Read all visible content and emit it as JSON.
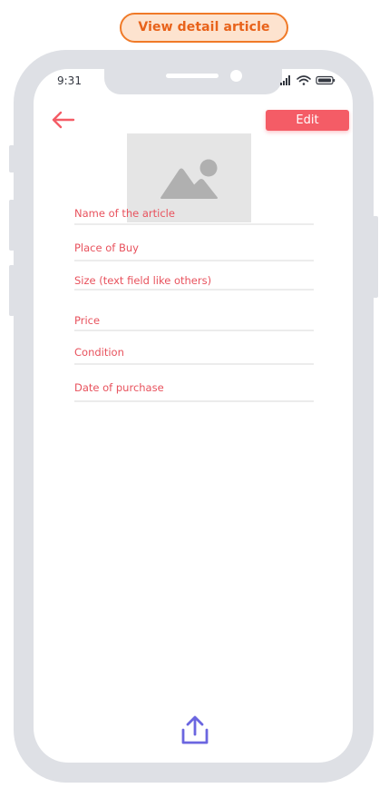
{
  "caption": "View detail article",
  "status_bar": {
    "time": "9:31",
    "icons": [
      "signal-icon",
      "wifi-icon",
      "battery-icon"
    ]
  },
  "header": {
    "back_icon": "arrow-left-icon",
    "edit_label": "Edit"
  },
  "image": {
    "icon": "image-placeholder-icon"
  },
  "fields": [
    {
      "label": "Name of the article"
    },
    {
      "label": "Place of Buy"
    },
    {
      "label": "Size (text field like others)"
    },
    {
      "label": "Price"
    },
    {
      "label": "Condition"
    },
    {
      "label": "Date of purchase"
    }
  ],
  "footer": {
    "share_icon": "share-upload-icon"
  },
  "colors": {
    "accent": "#f45c66",
    "label": "#e8525d",
    "caption_border": "#f07a28",
    "caption_bg": "#fde3cf",
    "share_icon": "#6b66e0",
    "frame": "#dee0e5"
  }
}
